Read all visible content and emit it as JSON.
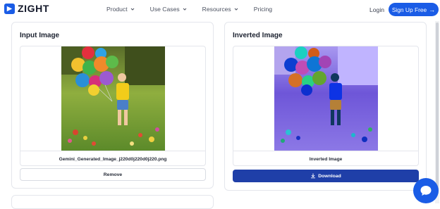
{
  "brand": {
    "name": "ZIGHT",
    "color": "#1a5ce6"
  },
  "nav": {
    "menu": [
      {
        "label": "Product",
        "has_dropdown": true
      },
      {
        "label": "Use Cases",
        "has_dropdown": true
      },
      {
        "label": "Resources",
        "has_dropdown": true
      },
      {
        "label": "Pricing",
        "has_dropdown": false
      }
    ],
    "login_label": "Login",
    "signup_label": "Sign Up Free",
    "signup_icon": "arrow-right-icon"
  },
  "input_panel": {
    "title": "Input Image",
    "file_name": "Gemini_Generated_Image_j220d0j220d0j220.png",
    "remove_label": "Remove"
  },
  "output_panel": {
    "title": "Inverted Image",
    "caption": "Inverted Image",
    "download_label": "Download",
    "download_icon": "download-icon"
  },
  "chat": {
    "icon": "chat-bubble-icon"
  },
  "colors": {
    "accent": "#1a5ce6",
    "download_button": "#1f3fa8",
    "border": "#e4e6ec"
  }
}
